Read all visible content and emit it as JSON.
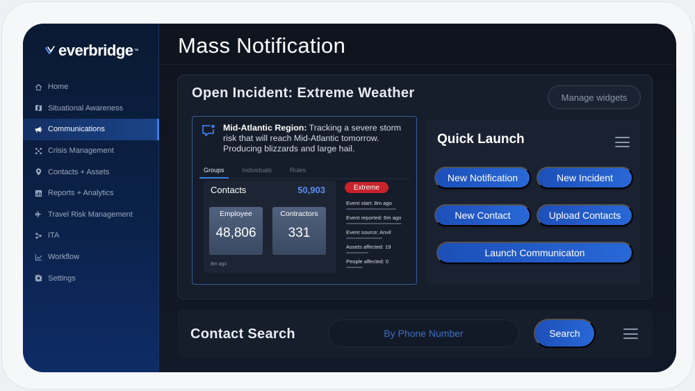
{
  "app": {
    "logo_text": "everbridge",
    "logo_tm": "™",
    "page_title": "Mass Notification"
  },
  "sidebar": {
    "items": [
      {
        "label": "Home",
        "icon": "home-icon"
      },
      {
        "label": "Situational Awareness",
        "icon": "map-icon"
      },
      {
        "label": "Communications",
        "icon": "megaphone-icon",
        "active": true
      },
      {
        "label": "Crisis Management",
        "icon": "network-icon"
      },
      {
        "label": "Contacts + Assets",
        "icon": "location-pin-icon"
      },
      {
        "label": "Reports + Analytics",
        "icon": "bar-chart-icon"
      },
      {
        "label": "Travel Risk Management",
        "icon": "airplane-icon"
      },
      {
        "label": "ITA",
        "icon": "nodes-icon"
      },
      {
        "label": "Workflow",
        "icon": "line-chart-icon"
      },
      {
        "label": "Settings",
        "icon": "gear-icon"
      }
    ]
  },
  "incident": {
    "title": "Open Incident: Extreme Weather",
    "manage_widgets_label": "Manage widgets",
    "alert": {
      "region": "Mid-Atlantic Region:",
      "message": " Tracking a severe storm risk that will reach Mid-Atlantic tomorrow. Producing blizzards and large hail."
    },
    "tabs": [
      {
        "label": "Groups",
        "active": true
      },
      {
        "label": "Individuals"
      },
      {
        "label": "Rules"
      }
    ],
    "contacts": {
      "label": "Contacts",
      "total": "50,903",
      "employee_label": "Employee",
      "employee_value": "48,806",
      "contractors_label": "Contractors",
      "contractors_value": "331",
      "time": "8m ago"
    },
    "severity": "Extreme",
    "events": [
      {
        "text": "Event start: 8m ago"
      },
      {
        "text": "Event reported: 6m ago"
      },
      {
        "text": "Event source: Anvil"
      },
      {
        "text": "Assets affected: 19"
      },
      {
        "text": "People affected: 0"
      }
    ]
  },
  "quick_launch": {
    "title": "Quick Launch",
    "buttons": {
      "new_notification": "New Notification",
      "new_incident": "New Incident",
      "new_contact": "New Contact",
      "upload_contacts": "Upload Contacts",
      "launch_communication": "Launch Communicaton"
    }
  },
  "contact_search": {
    "title": "Contact Search",
    "placeholder": "By Phone Number",
    "search_label": "Search"
  },
  "colors": {
    "accent": "#2868d6",
    "badge_extreme": "#c8232c",
    "contacts_total": "#5b8ff0"
  }
}
